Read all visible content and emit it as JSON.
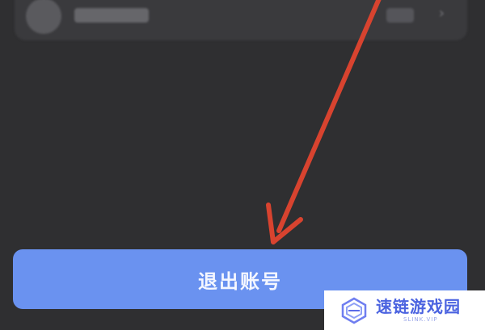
{
  "account_card": {
    "name": "••••••",
    "chevron_icon": "chevron-right-icon"
  },
  "annotation": {
    "arrow_color": "#d8432f",
    "arrow_icon": "arrow-down-left-icon"
  },
  "logout": {
    "label": "退出账号",
    "color": "#6a92f0"
  },
  "watermark": {
    "title": "速链游戏园",
    "subtitle": "SLINK.VIP",
    "logo_icon": "cube-logo-icon",
    "title_color": "#4b63e0"
  }
}
